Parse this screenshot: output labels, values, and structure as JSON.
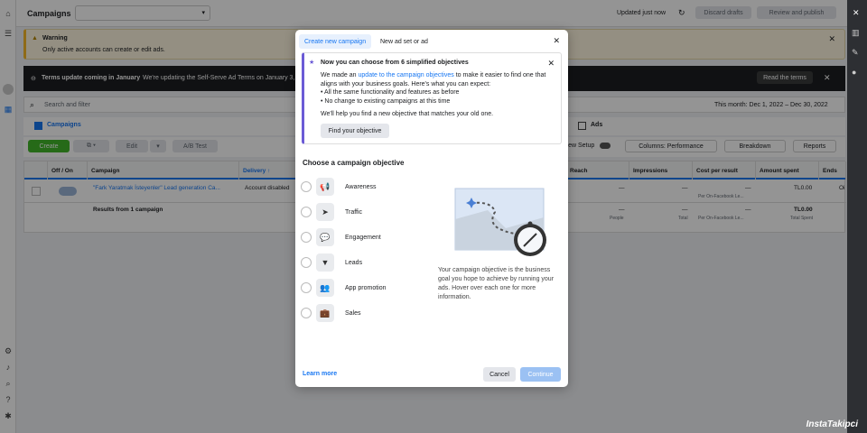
{
  "topbar": {
    "title": "Campaigns",
    "updated": "Updated just now",
    "discard": "Discard drafts",
    "review": "Review and publish"
  },
  "warning": {
    "title": "Warning",
    "text": "Only active accounts can create or edit ads."
  },
  "terms": {
    "title": "Terms update coming in January",
    "text": "We're updating the Self-Serve Ad Terms on January 3,",
    "read": "Read the terms"
  },
  "search": {
    "placeholder": "Search and filter",
    "date": "This month: Dec 1, 2022 – Dec 30, 2022"
  },
  "tabs": {
    "campaigns": "Campaigns",
    "ads": "Ads"
  },
  "toolbar": {
    "create": "Create",
    "edit": "Edit",
    "ab": "A/B Test",
    "view": "View Setup",
    "columns": "Columns: Performance",
    "breakdown": "Breakdown",
    "reports": "Reports"
  },
  "table": {
    "headers": {
      "offon": "Off / On",
      "campaign": "Campaign",
      "delivery": "Delivery ↑",
      "reach": "Reach",
      "impressions": "Impressions",
      "cpr": "Cost per result",
      "spent": "Amount spent",
      "ends": "Ends"
    },
    "row": {
      "campaign": "\"Fark Yaratmak İsteyenler\" Lead generation Ca...",
      "delivery": "Account disabled",
      "reach": "—",
      "impressions": "—",
      "cpr": "—",
      "cpr_sub": "Per On-Facebook Le...",
      "spent": "TL0.00",
      "ends": "Oi"
    },
    "summary": {
      "label": "Results from 1 campaign",
      "reach": "—",
      "reach_sub": "People",
      "impressions": "—",
      "impressions_sub": "Total",
      "cpr": "—",
      "cpr_sub": "Per On-Facebook Le...",
      "spent": "TL0.00",
      "spent_sub": "Total Spent"
    }
  },
  "modal": {
    "tab_create": "Create new campaign",
    "tab_new": "New ad set or ad",
    "notice_title": "Now you can choose from 6 simplified objectives",
    "notice_pre": "We made an ",
    "notice_link": "update to the campaign objectives",
    "notice_post": " to make it easier to find one that aligns with your business goals. Here's what you can expect:",
    "bullet1": "All the same functionality and features as before",
    "bullet2": "No change to existing campaigns at this time",
    "notice_help": "We'll help you find a new objective that matches your old one.",
    "find_btn": "Find your objective",
    "choose": "Choose a campaign objective",
    "objectives": [
      "Awareness",
      "Traffic",
      "Engagement",
      "Leads",
      "App promotion",
      "Sales"
    ],
    "description": "Your campaign objective is the business goal you hope to achieve by running your ads. Hover over each one for more information.",
    "learn": "Learn more",
    "cancel": "Cancel",
    "continue": "Continue"
  },
  "watermark": "InstaTakipci",
  "badges": {
    "notif": "1"
  }
}
